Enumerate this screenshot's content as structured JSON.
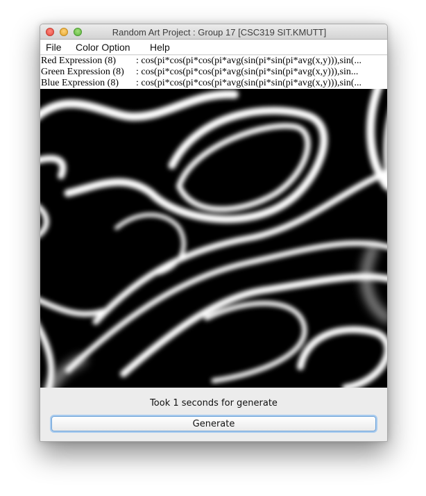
{
  "window": {
    "title": "Random Art Project : Group 17 [CSC319 SIT.KMUTT]"
  },
  "menu": {
    "file": "File",
    "color_option": "Color Option",
    "help": "Help"
  },
  "expressions": {
    "red_label": "Red Expression (8)",
    "red_value": ": cos(pi*cos(pi*cos(pi*avg(sin(pi*sin(pi*avg(x,y))),sin(...",
    "green_label": "Green Expression (8)",
    "green_value": ": cos(pi*cos(pi*cos(pi*avg(sin(pi*sin(pi*avg(x,y))),sin...",
    "blue_label": "Blue Expression (8)",
    "blue_value": ": cos(pi*cos(pi*cos(pi*avg(sin(pi*sin(pi*avg(x,y))),sin(..."
  },
  "status": {
    "text": "Took 1 seconds for generate"
  },
  "buttons": {
    "generate": "Generate"
  },
  "colors": {
    "art_background": "#000000",
    "art_stroke": "#ffffff",
    "button_focus": "#a8cbef"
  }
}
